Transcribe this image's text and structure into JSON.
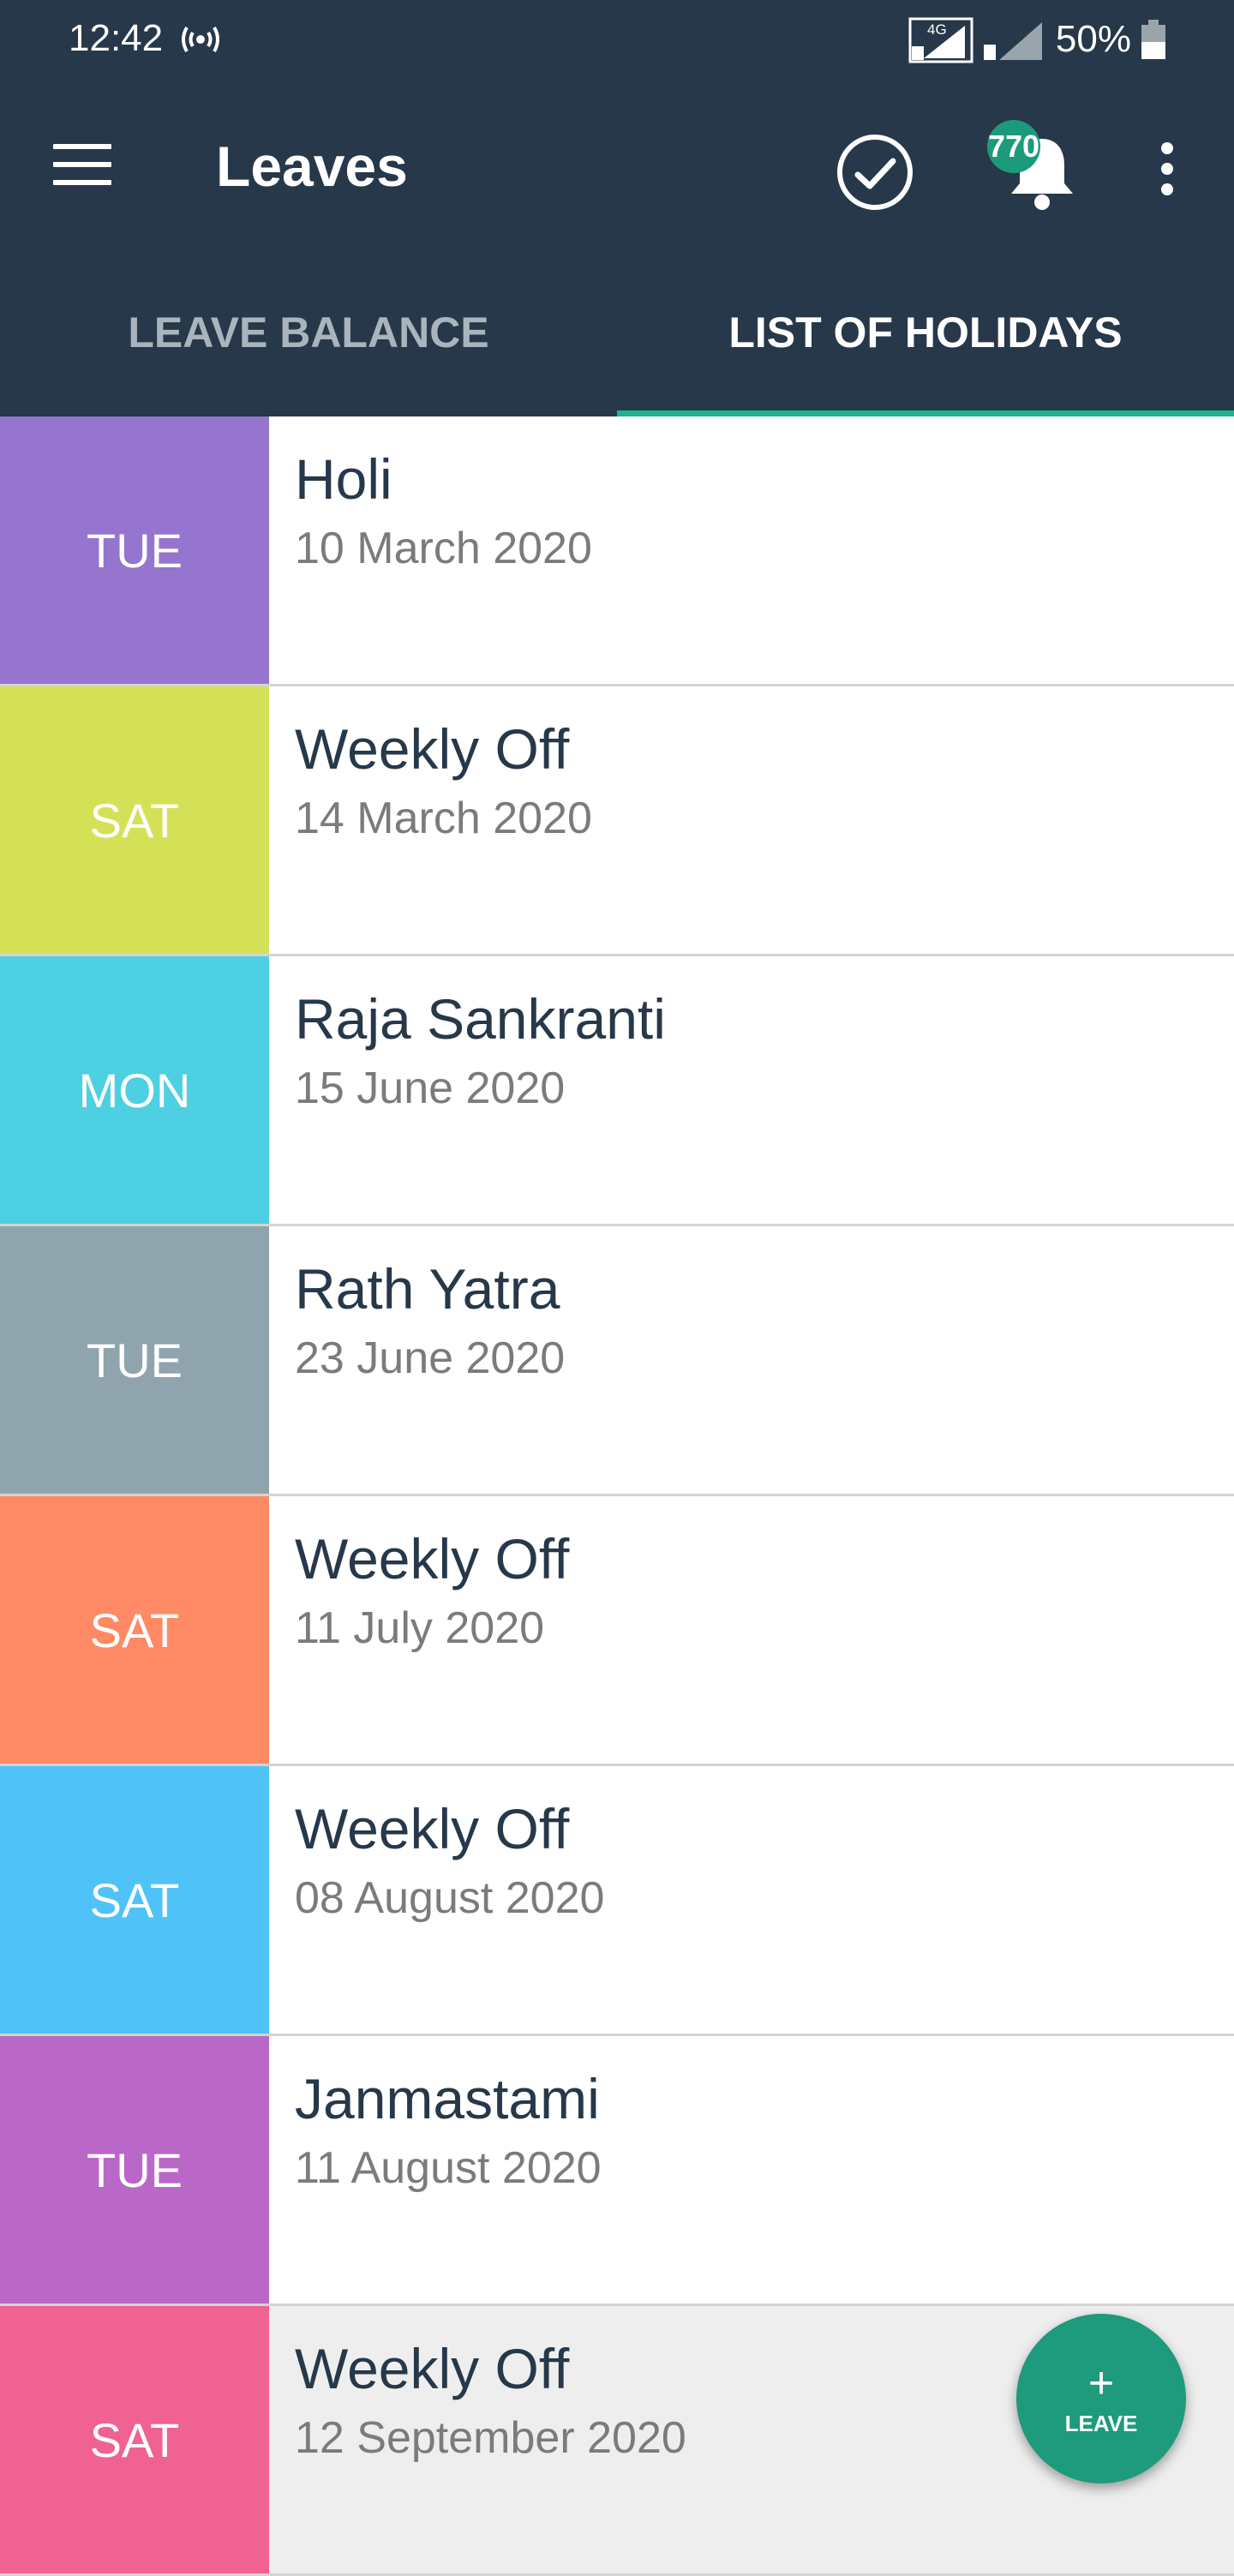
{
  "status_bar": {
    "time": "12:42",
    "network": "4G",
    "battery_percent": "50%",
    "icons": [
      "hotspot-icon",
      "sim1-signal-icon",
      "sim2-signal-icon",
      "battery-icon"
    ]
  },
  "app_bar": {
    "title": "Leaves",
    "notification_count": "770",
    "icons": [
      "menu-icon",
      "check-circle-icon",
      "bell-icon",
      "more-vert-icon"
    ]
  },
  "tabs": [
    {
      "label": "LEAVE BALANCE",
      "active": false
    },
    {
      "label": "LIST OF HOLIDAYS",
      "active": true
    }
  ],
  "holidays": [
    {
      "day": "TUE",
      "name": "Holi",
      "date": "10 March 2020",
      "color": "#9575cd"
    },
    {
      "day": "SAT",
      "name": "Weekly Off",
      "date": "14 March 2020",
      "color": "#d4e157"
    },
    {
      "day": "MON",
      "name": "Raja Sankranti",
      "date": "15 June 2020",
      "color": "#4dd0e1"
    },
    {
      "day": "TUE",
      "name": "Rath Yatra",
      "date": "23 June 2020",
      "color": "#90a4ae"
    },
    {
      "day": "SAT",
      "name": "Weekly Off",
      "date": "11 July 2020",
      "color": "#ff8a65"
    },
    {
      "day": "SAT",
      "name": "Weekly Off",
      "date": "08 August 2020",
      "color": "#4fc3f7"
    },
    {
      "day": "TUE",
      "name": "Janmastami",
      "date": "11 August 2020",
      "color": "#ba68c8"
    },
    {
      "day": "SAT",
      "name": "Weekly Off",
      "date": "12 September 2020",
      "color": "#f06292"
    }
  ],
  "fab": {
    "plus": "+",
    "label": "LEAVE"
  },
  "colors": {
    "header_bg": "#263849",
    "tab_indicator": "#1eb38f",
    "badge": "#1c9a7c",
    "fab": "#1e9a7d"
  }
}
